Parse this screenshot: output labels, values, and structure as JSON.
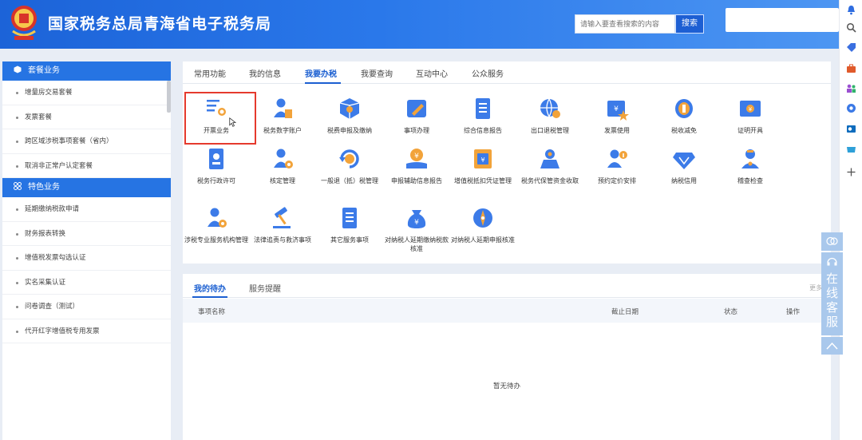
{
  "header": {
    "title": "国家税务总局青海省电子税务局",
    "search_placeholder": "请输入要查看搜索的内容",
    "search_button": "搜索",
    "emblem_icon": "tax-emblem-icon",
    "brand_color": "#1c63d8"
  },
  "sidebar": {
    "sections": [
      {
        "title": "套餐业务",
        "icon": "cube-icon",
        "items": [
          "增量房交易套餐",
          "发票套餐",
          "跨区域涉税事项套餐（省内）",
          "取消非正常户认定套餐"
        ]
      },
      {
        "title": "特色业务",
        "icon": "grid-icon",
        "items": [
          "延期缴纳税款申请",
          "财务报表转换",
          "增值税发票勾选认证",
          "实名采集认证",
          "问卷调查（测试）",
          "代开红字增值税专用发票"
        ]
      }
    ]
  },
  "tabs": [
    "常用功能",
    "我的信息",
    "我要办税",
    "我要查询",
    "互动中心",
    "公众服务"
  ],
  "active_tab": "我要办税",
  "tiles": [
    {
      "label": "开票业务",
      "icon": "invoice-list-icon"
    },
    {
      "label": "税务数字账户",
      "icon": "user-account-icon"
    },
    {
      "label": "税费申报及缴纳",
      "icon": "box-icon"
    },
    {
      "label": "事项办理",
      "icon": "pen-card-icon"
    },
    {
      "label": "综合信息报告",
      "icon": "document-icon"
    },
    {
      "label": "出口退税管理",
      "icon": "globe-icon"
    },
    {
      "label": "发票使用",
      "icon": "ticket-star-icon"
    },
    {
      "label": "税收减免",
      "icon": "coins-icon"
    },
    {
      "label": "证明开具",
      "icon": "certificate-icon"
    },
    {
      "label": "税务行政许可",
      "icon": "permit-icon"
    },
    {
      "label": "核定管理",
      "icon": "user-gear-icon"
    },
    {
      "label": "一般退（抵）税管理",
      "icon": "refund-icon"
    },
    {
      "label": "申报辅助信息报告",
      "icon": "hand-coin-icon"
    },
    {
      "label": "增值税抵扣凭证管理",
      "icon": "receipt-icon"
    },
    {
      "label": "税务代保管资金收取",
      "icon": "safe-icon"
    },
    {
      "label": "预约定价安排",
      "icon": "user-info-icon"
    },
    {
      "label": "纳税信用",
      "icon": "diamond-icon"
    },
    {
      "label": "稽查检查",
      "icon": "inspector-icon"
    },
    {
      "label": "涉税专业服务机构管理",
      "icon": "user-gear-icon"
    },
    {
      "label": "法律追责与救济事项",
      "icon": "gavel-icon"
    },
    {
      "label": "其它服务事项",
      "icon": "document-icon"
    },
    {
      "label": "对纳税人延期缴纳税款核准",
      "icon": "money-bag-icon"
    },
    {
      "label": "对纳税人延期申报核准",
      "icon": "compass-icon"
    }
  ],
  "todo": {
    "tabs": [
      "我的待办",
      "服务提醒"
    ],
    "more": "更多»",
    "columns": [
      "事项名称",
      "截止日期",
      "状态",
      "操作"
    ],
    "empty_text": "暂无待办"
  },
  "online_service": {
    "text": [
      "在",
      "线",
      "客",
      "服"
    ]
  }
}
